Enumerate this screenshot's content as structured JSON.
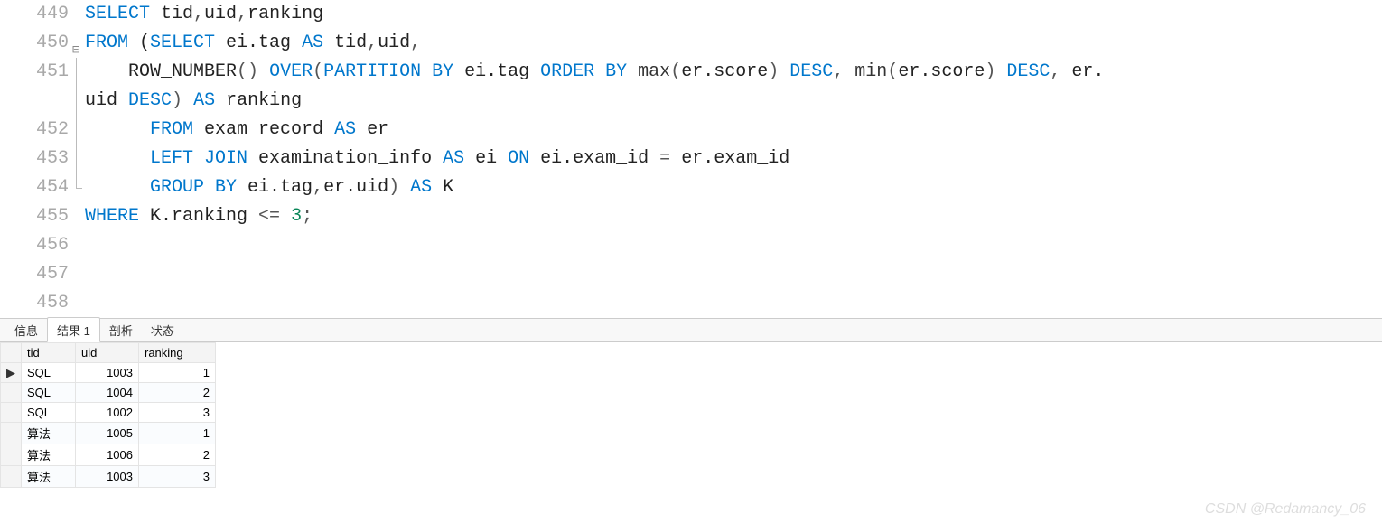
{
  "editor": {
    "lines": [
      {
        "n": "449",
        "fold": "",
        "tokens": [
          {
            "c": "kw",
            "t": "SELECT"
          },
          {
            "c": "id",
            "t": " tid"
          },
          {
            "c": "op",
            "t": ","
          },
          {
            "c": "id",
            "t": "uid"
          },
          {
            "c": "op",
            "t": ","
          },
          {
            "c": "id",
            "t": "ranking"
          }
        ]
      },
      {
        "n": "450",
        "fold": "mark",
        "tokens": [
          {
            "c": "kw",
            "t": "FROM"
          },
          {
            "c": "id",
            "t": " ("
          },
          {
            "c": "kw",
            "t": "SELECT"
          },
          {
            "c": "id",
            "t": " ei.tag "
          },
          {
            "c": "kw",
            "t": "AS"
          },
          {
            "c": "id",
            "t": " tid"
          },
          {
            "c": "op",
            "t": ","
          },
          {
            "c": "id",
            "t": "uid"
          },
          {
            "c": "op",
            "t": ","
          }
        ]
      },
      {
        "n": "451",
        "fold": "line",
        "tokens": [
          {
            "c": "id",
            "t": "    ROW_NUMBER"
          },
          {
            "c": "op",
            "t": "()"
          },
          {
            "c": "id",
            "t": " "
          },
          {
            "c": "kw",
            "t": "OVER"
          },
          {
            "c": "op",
            "t": "("
          },
          {
            "c": "kw",
            "t": "PARTITION BY"
          },
          {
            "c": "id",
            "t": " ei.tag "
          },
          {
            "c": "kw",
            "t": "ORDER BY"
          },
          {
            "c": "id",
            "t": " "
          },
          {
            "c": "fn",
            "t": "max"
          },
          {
            "c": "op",
            "t": "("
          },
          {
            "c": "id",
            "t": "er.score"
          },
          {
            "c": "op",
            "t": ")"
          },
          {
            "c": "id",
            "t": " "
          },
          {
            "c": "kw",
            "t": "DESC"
          },
          {
            "c": "op",
            "t": ","
          },
          {
            "c": "id",
            "t": " "
          },
          {
            "c": "fn",
            "t": "min"
          },
          {
            "c": "op",
            "t": "("
          },
          {
            "c": "id",
            "t": "er.score"
          },
          {
            "c": "op",
            "t": ")"
          },
          {
            "c": "id",
            "t": " "
          },
          {
            "c": "kw",
            "t": "DESC"
          },
          {
            "c": "op",
            "t": ","
          },
          {
            "c": "id",
            "t": " er."
          }
        ]
      },
      {
        "n": "",
        "fold": "line",
        "tokens": [
          {
            "c": "id",
            "t": "uid "
          },
          {
            "c": "kw",
            "t": "DESC"
          },
          {
            "c": "op",
            "t": ")"
          },
          {
            "c": "id",
            "t": " "
          },
          {
            "c": "kw",
            "t": "AS"
          },
          {
            "c": "id",
            "t": " ranking"
          }
        ]
      },
      {
        "n": "452",
        "fold": "line",
        "tokens": [
          {
            "c": "id",
            "t": "      "
          },
          {
            "c": "kw",
            "t": "FROM"
          },
          {
            "c": "id",
            "t": " exam_record "
          },
          {
            "c": "kw",
            "t": "AS"
          },
          {
            "c": "id",
            "t": " er"
          }
        ]
      },
      {
        "n": "453",
        "fold": "line",
        "tokens": [
          {
            "c": "id",
            "t": "      "
          },
          {
            "c": "kw",
            "t": "LEFT JOIN"
          },
          {
            "c": "id",
            "t": " examination_info "
          },
          {
            "c": "kw",
            "t": "AS"
          },
          {
            "c": "id",
            "t": " ei "
          },
          {
            "c": "kw",
            "t": "ON"
          },
          {
            "c": "id",
            "t": " ei.exam_id "
          },
          {
            "c": "op",
            "t": "="
          },
          {
            "c": "id",
            "t": " er.exam_id"
          }
        ]
      },
      {
        "n": "454",
        "fold": "end",
        "tokens": [
          {
            "c": "id",
            "t": "      "
          },
          {
            "c": "kw",
            "t": "GROUP BY"
          },
          {
            "c": "id",
            "t": " ei.tag"
          },
          {
            "c": "op",
            "t": ","
          },
          {
            "c": "id",
            "t": "er.uid"
          },
          {
            "c": "op",
            "t": ")"
          },
          {
            "c": "id",
            "t": " "
          },
          {
            "c": "kw",
            "t": "AS"
          },
          {
            "c": "id",
            "t": " K"
          }
        ]
      },
      {
        "n": "455",
        "fold": "",
        "tokens": [
          {
            "c": "kw",
            "t": "WHERE"
          },
          {
            "c": "id",
            "t": " K.ranking "
          },
          {
            "c": "op",
            "t": "<="
          },
          {
            "c": "id",
            "t": " "
          },
          {
            "c": "num",
            "t": "3"
          },
          {
            "c": "op",
            "t": ";"
          }
        ]
      },
      {
        "n": "456",
        "fold": "",
        "tokens": []
      },
      {
        "n": "457",
        "fold": "",
        "tokens": []
      },
      {
        "n": "458",
        "fold": "",
        "tokens": []
      }
    ]
  },
  "tabs": {
    "items": [
      "信息",
      "结果 1",
      "剖析",
      "状态"
    ],
    "active_index": 1
  },
  "results": {
    "columns": [
      "tid",
      "uid",
      "ranking"
    ],
    "current_row_index": 0,
    "rows": [
      {
        "tid": "SQL",
        "uid": "1003",
        "ranking": "1"
      },
      {
        "tid": "SQL",
        "uid": "1004",
        "ranking": "2"
      },
      {
        "tid": "SQL",
        "uid": "1002",
        "ranking": "3"
      },
      {
        "tid": "算法",
        "uid": "1005",
        "ranking": "1"
      },
      {
        "tid": "算法",
        "uid": "1006",
        "ranking": "2"
      },
      {
        "tid": "算法",
        "uid": "1003",
        "ranking": "3"
      }
    ]
  },
  "watermark": "CSDN @Redamancy_06"
}
